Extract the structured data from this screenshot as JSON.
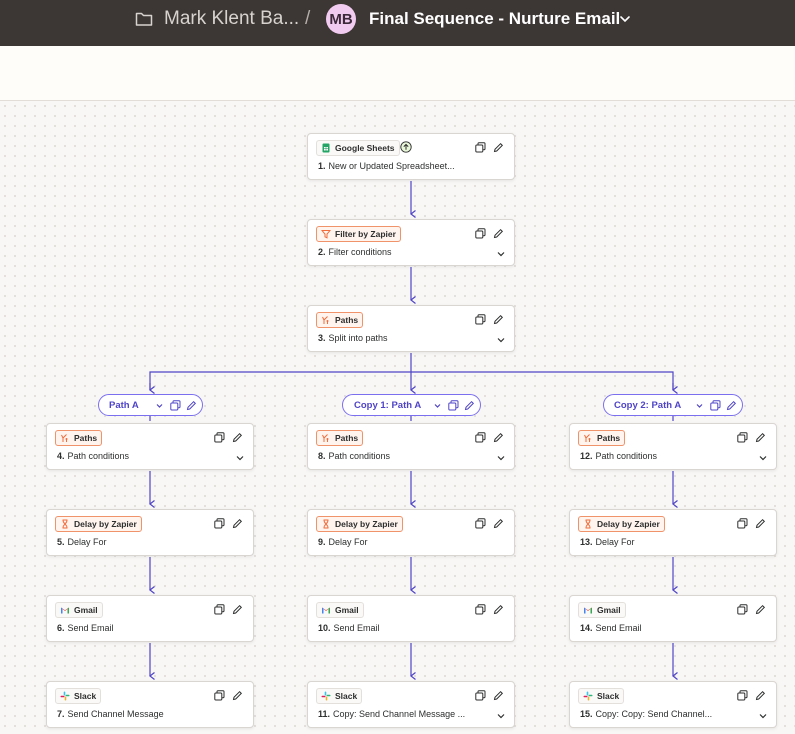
{
  "header": {
    "folder_name": "Mark Klent Ba...",
    "separator": "/",
    "avatar_initials": "MB",
    "zap_title": "Final Sequence - Nurture Email"
  },
  "colors": {
    "header_bg": "#3c3634",
    "connector": "#4f44c7",
    "accent_orange": "#f0926a",
    "avatar_bg": "#f2cbf0"
  },
  "steps": {
    "s1": {
      "app": "Google Sheets",
      "num": "1.",
      "label": "New or Updated Spreadsheet...",
      "icon": "google-sheets-icon"
    },
    "s2": {
      "app": "Filter by Zapier",
      "num": "2.",
      "label": "Filter conditions",
      "icon": "filter-icon"
    },
    "s3": {
      "app": "Paths",
      "num": "3.",
      "label": "Split into paths",
      "icon": "paths-icon"
    },
    "s4": {
      "app": "Paths",
      "num": "4.",
      "label": "Path conditions",
      "icon": "paths-icon"
    },
    "s5": {
      "app": "Delay by Zapier",
      "num": "5.",
      "label": "Delay For",
      "icon": "hourglass-icon"
    },
    "s6": {
      "app": "Gmail",
      "num": "6.",
      "label": "Send Email",
      "icon": "gmail-icon"
    },
    "s7": {
      "app": "Slack",
      "num": "7.",
      "label": "Send Channel Message",
      "icon": "slack-icon"
    },
    "s8": {
      "app": "Paths",
      "num": "8.",
      "label": "Path conditions",
      "icon": "paths-icon"
    },
    "s9": {
      "app": "Delay by Zapier",
      "num": "9.",
      "label": "Delay For",
      "icon": "hourglass-icon"
    },
    "s10": {
      "app": "Gmail",
      "num": "10.",
      "label": "Send Email",
      "icon": "gmail-icon"
    },
    "s11": {
      "app": "Slack",
      "num": "11.",
      "label": "Copy: Send Channel Message ...",
      "icon": "slack-icon"
    },
    "s12": {
      "app": "Paths",
      "num": "12.",
      "label": "Path conditions",
      "icon": "paths-icon"
    },
    "s13": {
      "app": "Delay by Zapier",
      "num": "13.",
      "label": "Delay For",
      "icon": "hourglass-icon"
    },
    "s14": {
      "app": "Gmail",
      "num": "14.",
      "label": "Send Email",
      "icon": "gmail-icon"
    },
    "s15": {
      "app": "Slack",
      "num": "15.",
      "label": "Copy: Copy: Send Channel...",
      "icon": "slack-icon"
    }
  },
  "paths": {
    "a": "Path A",
    "b": "Copy 1: Path A",
    "c": "Copy 2: Path A"
  }
}
